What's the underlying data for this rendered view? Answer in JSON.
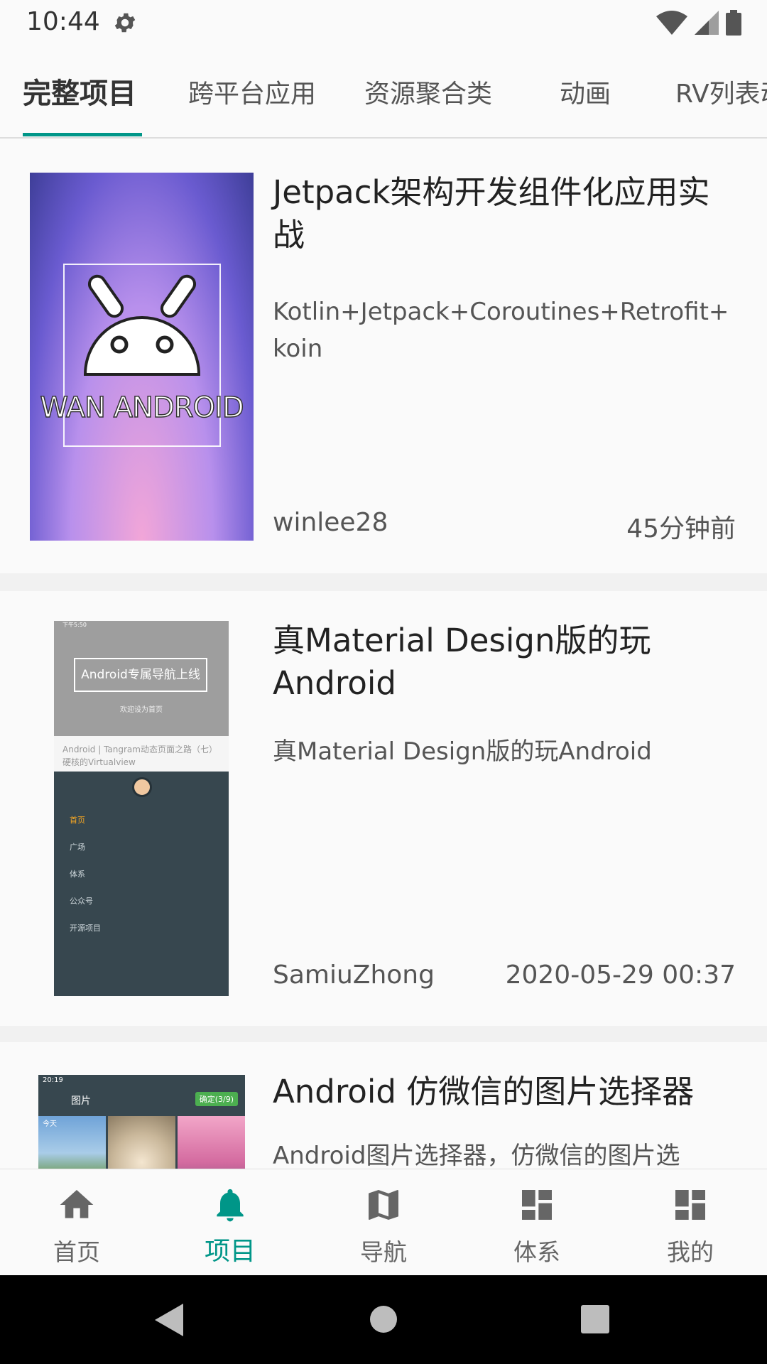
{
  "status": {
    "time": "10:44"
  },
  "tabs": [
    {
      "label": "完整项目",
      "active": true
    },
    {
      "label": "跨平台应用",
      "active": false
    },
    {
      "label": "资源聚合类",
      "active": false
    },
    {
      "label": "动画",
      "active": false
    },
    {
      "label": "RV列表动",
      "active": false
    }
  ],
  "projects": [
    {
      "title": "Jetpack架构开发组件化应用实战",
      "desc": "Kotlin+Jetpack+Coroutines+Retrofit+koin",
      "author": "winlee28",
      "time": "45分钟前",
      "thumb_text": "WAN ANDROID"
    },
    {
      "title": "真Material Design版的玩Android",
      "desc": "真Material Design版的玩Android",
      "author": "SamiuZhong",
      "time": "2020-05-29 00:37",
      "thumb": {
        "status": "下午5:50",
        "banner": "Android专属导航上线",
        "banner_sub": "欢迎设为首页",
        "article": "Android | Tangram动态页面之路（七）硬核的Virtualview",
        "menu": [
          "首页",
          "广场",
          "体系",
          "公众号",
          "开源项目"
        ]
      }
    },
    {
      "title": "Android 仿微信的图片选择器",
      "desc": "Android图片选择器，仿微信的图片选",
      "thumb": {
        "status": "20:19",
        "header": "图片",
        "confirm": "确定(3/9)",
        "today": "今天"
      }
    }
  ],
  "bottom_nav": [
    {
      "label": "首页",
      "icon": "home-icon",
      "active": false
    },
    {
      "label": "项目",
      "icon": "bell-icon",
      "active": true
    },
    {
      "label": "导航",
      "icon": "map-icon",
      "active": false
    },
    {
      "label": "体系",
      "icon": "dashboard-icon",
      "active": false
    },
    {
      "label": "我的",
      "icon": "dashboard-icon",
      "active": false
    }
  ],
  "colors": {
    "accent": "#009688",
    "background": "#FAFAFA",
    "divider": "#F1F1F1"
  }
}
